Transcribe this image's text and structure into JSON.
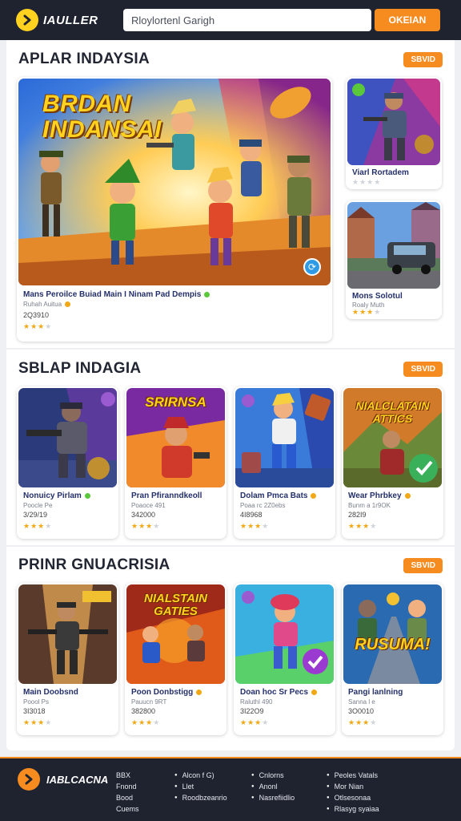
{
  "header": {
    "logo_text": "IAULLER",
    "search_placeholder": "Rloylortenl Garigh",
    "search_button": "OKEIAN"
  },
  "sections": [
    {
      "title": "APLAR INDAYSIA",
      "see_all": "SBVID",
      "hero": {
        "banner": "BRDAN\nINDANSAI",
        "title": "Mans Peroilce Buiad Main I Ninam Pad Dempis",
        "subtitle": "Ruhah Auitua",
        "number": "2Q3910",
        "rating": 3
      },
      "side": [
        {
          "title": "Viarl Rortadem",
          "subtitle": "",
          "number": "",
          "rating": 0
        },
        {
          "title": "Mons Solotul",
          "subtitle": "Roaly Muth",
          "number": "",
          "rating": 3
        }
      ]
    },
    {
      "title": "SBLAP INDAGIA",
      "see_all": "SBVID",
      "cards": [
        {
          "title": "Nonuicy Pirlam",
          "subtitle": "Poocle Pe",
          "number": "3/29/19",
          "rating": 3,
          "banner": ""
        },
        {
          "title": "Pran Pfiranndkeoll",
          "subtitle": "Poaoce 491",
          "number": "342000",
          "rating": 3,
          "banner": "SRIRNSA"
        },
        {
          "title": "Dolam Pmca Bats",
          "subtitle": "Poaa rc 2Z0ebs",
          "number": "4I8968",
          "rating": 3,
          "banner": ""
        },
        {
          "title": "Wear Phrbkey",
          "subtitle": "Bunm a 1r9OK",
          "number": "282I9",
          "rating": 3,
          "banner": "NIALCLATAIN\nATTICS"
        }
      ]
    },
    {
      "title": "PRINR GNUACRISIA",
      "see_all": "SBVID",
      "cards": [
        {
          "title": "Main Doobsnd",
          "subtitle": "Poool Ps",
          "number": "3I3018",
          "rating": 3,
          "banner": ""
        },
        {
          "title": "Poon Donbstigg",
          "subtitle": "Pauucn 9RT",
          "number": "382800",
          "rating": 3,
          "banner": "NIALSTAIN\nGATIES"
        },
        {
          "title": "Doan hoc Sr Pecs",
          "subtitle": "Raluthl 490",
          "number": "3I22O9",
          "rating": 3,
          "banner": ""
        },
        {
          "title": "Pangi lanlning",
          "subtitle": "Sanna l e",
          "number": "3O0010",
          "rating": 3,
          "banner": "RUSUMA!"
        }
      ]
    }
  ],
  "footer": {
    "logo_text": "IABLCACNA",
    "col1": [
      "BBX",
      "Fnond",
      "Bood",
      "Cuems"
    ],
    "col2": [
      "Alcon f G)",
      "Llet",
      "Roodbzeanrio"
    ],
    "col3": [
      "Cnlorns",
      "Anonl",
      "Nasrefiidlio"
    ],
    "col4": [
      "Peoles Vatals",
      "Mor Nian",
      "Otlsesonaa",
      "Rlasyg syaiaa"
    ]
  },
  "colors": {
    "accent": "#f68b1f",
    "header_bg": "#1f2330",
    "logo_yellow": "#ffd21f",
    "star": "#f2a814"
  }
}
